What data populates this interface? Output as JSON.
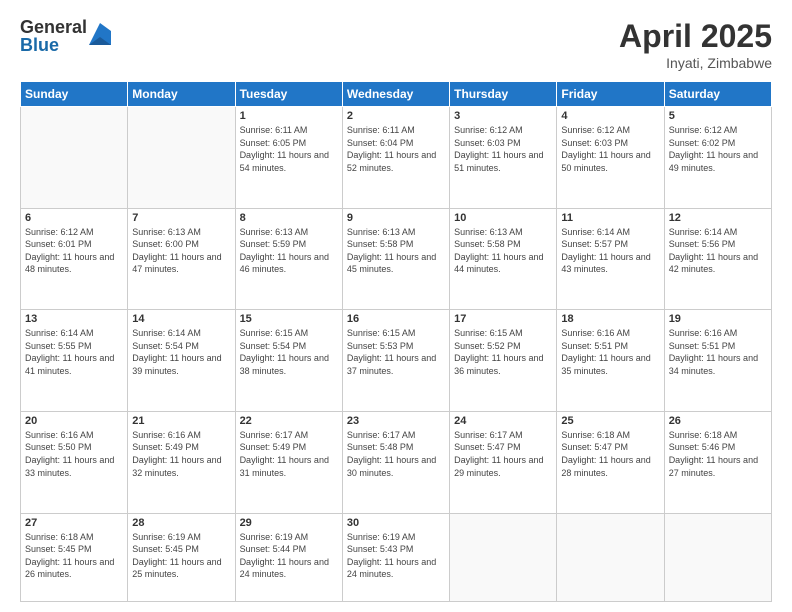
{
  "logo": {
    "general": "General",
    "blue": "Blue"
  },
  "title": "April 2025",
  "subtitle": "Inyati, Zimbabwe",
  "headers": [
    "Sunday",
    "Monday",
    "Tuesday",
    "Wednesday",
    "Thursday",
    "Friday",
    "Saturday"
  ],
  "weeks": [
    [
      {
        "day": "",
        "info": ""
      },
      {
        "day": "",
        "info": ""
      },
      {
        "day": "1",
        "info": "Sunrise: 6:11 AM\nSunset: 6:05 PM\nDaylight: 11 hours and 54 minutes."
      },
      {
        "day": "2",
        "info": "Sunrise: 6:11 AM\nSunset: 6:04 PM\nDaylight: 11 hours and 52 minutes."
      },
      {
        "day": "3",
        "info": "Sunrise: 6:12 AM\nSunset: 6:03 PM\nDaylight: 11 hours and 51 minutes."
      },
      {
        "day": "4",
        "info": "Sunrise: 6:12 AM\nSunset: 6:03 PM\nDaylight: 11 hours and 50 minutes."
      },
      {
        "day": "5",
        "info": "Sunrise: 6:12 AM\nSunset: 6:02 PM\nDaylight: 11 hours and 49 minutes."
      }
    ],
    [
      {
        "day": "6",
        "info": "Sunrise: 6:12 AM\nSunset: 6:01 PM\nDaylight: 11 hours and 48 minutes."
      },
      {
        "day": "7",
        "info": "Sunrise: 6:13 AM\nSunset: 6:00 PM\nDaylight: 11 hours and 47 minutes."
      },
      {
        "day": "8",
        "info": "Sunrise: 6:13 AM\nSunset: 5:59 PM\nDaylight: 11 hours and 46 minutes."
      },
      {
        "day": "9",
        "info": "Sunrise: 6:13 AM\nSunset: 5:58 PM\nDaylight: 11 hours and 45 minutes."
      },
      {
        "day": "10",
        "info": "Sunrise: 6:13 AM\nSunset: 5:58 PM\nDaylight: 11 hours and 44 minutes."
      },
      {
        "day": "11",
        "info": "Sunrise: 6:14 AM\nSunset: 5:57 PM\nDaylight: 11 hours and 43 minutes."
      },
      {
        "day": "12",
        "info": "Sunrise: 6:14 AM\nSunset: 5:56 PM\nDaylight: 11 hours and 42 minutes."
      }
    ],
    [
      {
        "day": "13",
        "info": "Sunrise: 6:14 AM\nSunset: 5:55 PM\nDaylight: 11 hours and 41 minutes."
      },
      {
        "day": "14",
        "info": "Sunrise: 6:14 AM\nSunset: 5:54 PM\nDaylight: 11 hours and 39 minutes."
      },
      {
        "day": "15",
        "info": "Sunrise: 6:15 AM\nSunset: 5:54 PM\nDaylight: 11 hours and 38 minutes."
      },
      {
        "day": "16",
        "info": "Sunrise: 6:15 AM\nSunset: 5:53 PM\nDaylight: 11 hours and 37 minutes."
      },
      {
        "day": "17",
        "info": "Sunrise: 6:15 AM\nSunset: 5:52 PM\nDaylight: 11 hours and 36 minutes."
      },
      {
        "day": "18",
        "info": "Sunrise: 6:16 AM\nSunset: 5:51 PM\nDaylight: 11 hours and 35 minutes."
      },
      {
        "day": "19",
        "info": "Sunrise: 6:16 AM\nSunset: 5:51 PM\nDaylight: 11 hours and 34 minutes."
      }
    ],
    [
      {
        "day": "20",
        "info": "Sunrise: 6:16 AM\nSunset: 5:50 PM\nDaylight: 11 hours and 33 minutes."
      },
      {
        "day": "21",
        "info": "Sunrise: 6:16 AM\nSunset: 5:49 PM\nDaylight: 11 hours and 32 minutes."
      },
      {
        "day": "22",
        "info": "Sunrise: 6:17 AM\nSunset: 5:49 PM\nDaylight: 11 hours and 31 minutes."
      },
      {
        "day": "23",
        "info": "Sunrise: 6:17 AM\nSunset: 5:48 PM\nDaylight: 11 hours and 30 minutes."
      },
      {
        "day": "24",
        "info": "Sunrise: 6:17 AM\nSunset: 5:47 PM\nDaylight: 11 hours and 29 minutes."
      },
      {
        "day": "25",
        "info": "Sunrise: 6:18 AM\nSunset: 5:47 PM\nDaylight: 11 hours and 28 minutes."
      },
      {
        "day": "26",
        "info": "Sunrise: 6:18 AM\nSunset: 5:46 PM\nDaylight: 11 hours and 27 minutes."
      }
    ],
    [
      {
        "day": "27",
        "info": "Sunrise: 6:18 AM\nSunset: 5:45 PM\nDaylight: 11 hours and 26 minutes."
      },
      {
        "day": "28",
        "info": "Sunrise: 6:19 AM\nSunset: 5:45 PM\nDaylight: 11 hours and 25 minutes."
      },
      {
        "day": "29",
        "info": "Sunrise: 6:19 AM\nSunset: 5:44 PM\nDaylight: 11 hours and 24 minutes."
      },
      {
        "day": "30",
        "info": "Sunrise: 6:19 AM\nSunset: 5:43 PM\nDaylight: 11 hours and 24 minutes."
      },
      {
        "day": "",
        "info": ""
      },
      {
        "day": "",
        "info": ""
      },
      {
        "day": "",
        "info": ""
      }
    ]
  ]
}
